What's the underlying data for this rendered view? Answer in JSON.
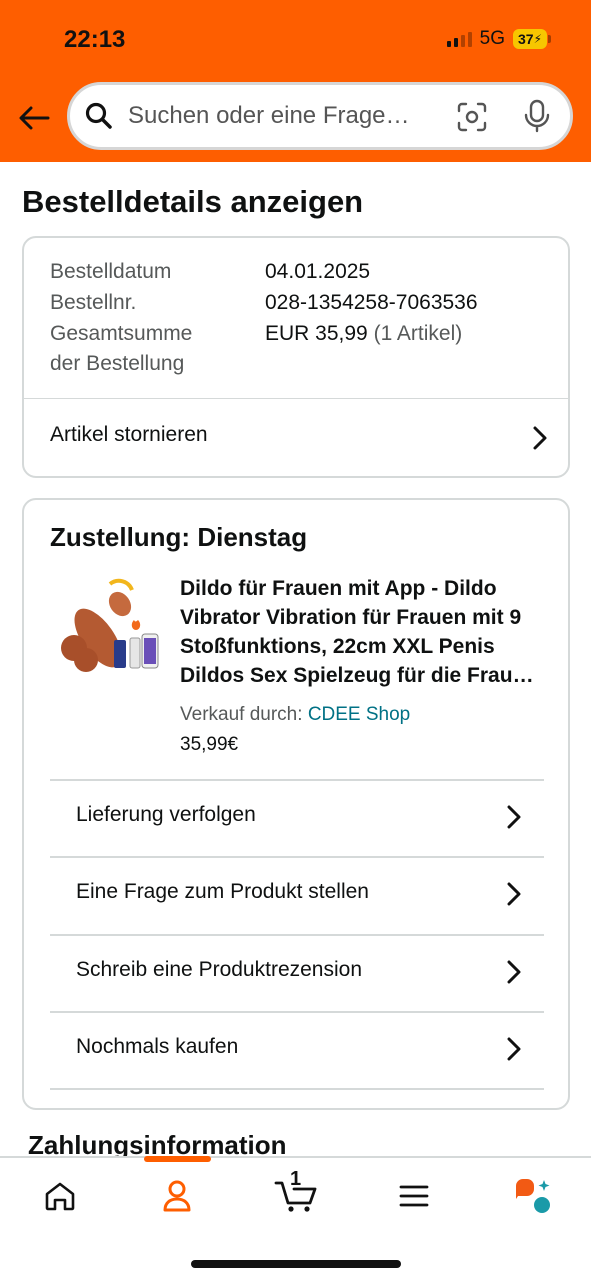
{
  "status_bar": {
    "time": "22:13",
    "network": "5G",
    "battery": "37"
  },
  "search": {
    "placeholder": "Suchen oder eine Frage…"
  },
  "page": {
    "title": "Bestelldetails anzeigen"
  },
  "order": {
    "date_label": "Bestelldatum",
    "date_value": "04.01.2025",
    "number_label": "Bestellnr.",
    "number_value": "028-1354258-7063536",
    "total_label_1": "Gesamtsumme",
    "total_label_2": "der Bestellung",
    "total_value": "EUR 35,99",
    "total_items": "(1 Artikel)",
    "cancel_label": "Artikel stornieren"
  },
  "delivery": {
    "title": "Zustellung: Dienstag",
    "product_title": "Dildo für Frauen mit App - Dildo Vibrator Vibration für Frauen mit 9 Stoßfunktions, 22cm XXL Penis Dildos Sex Spielzeug für die Frau Vagina",
    "seller_label": "Verkauf durch:",
    "seller_name": "CDEE Shop",
    "price": "35,99€",
    "actions": [
      "Lieferung verfolgen",
      "Eine Frage zum Produkt stellen",
      "Schreib eine Produktrezension",
      "Nochmals kaufen"
    ]
  },
  "payment": {
    "title": "Zahlungsinformation"
  },
  "bottom_nav": {
    "cart_count": "1"
  },
  "colors": {
    "brand_orange": "#fe5e00",
    "link": "#007185"
  }
}
